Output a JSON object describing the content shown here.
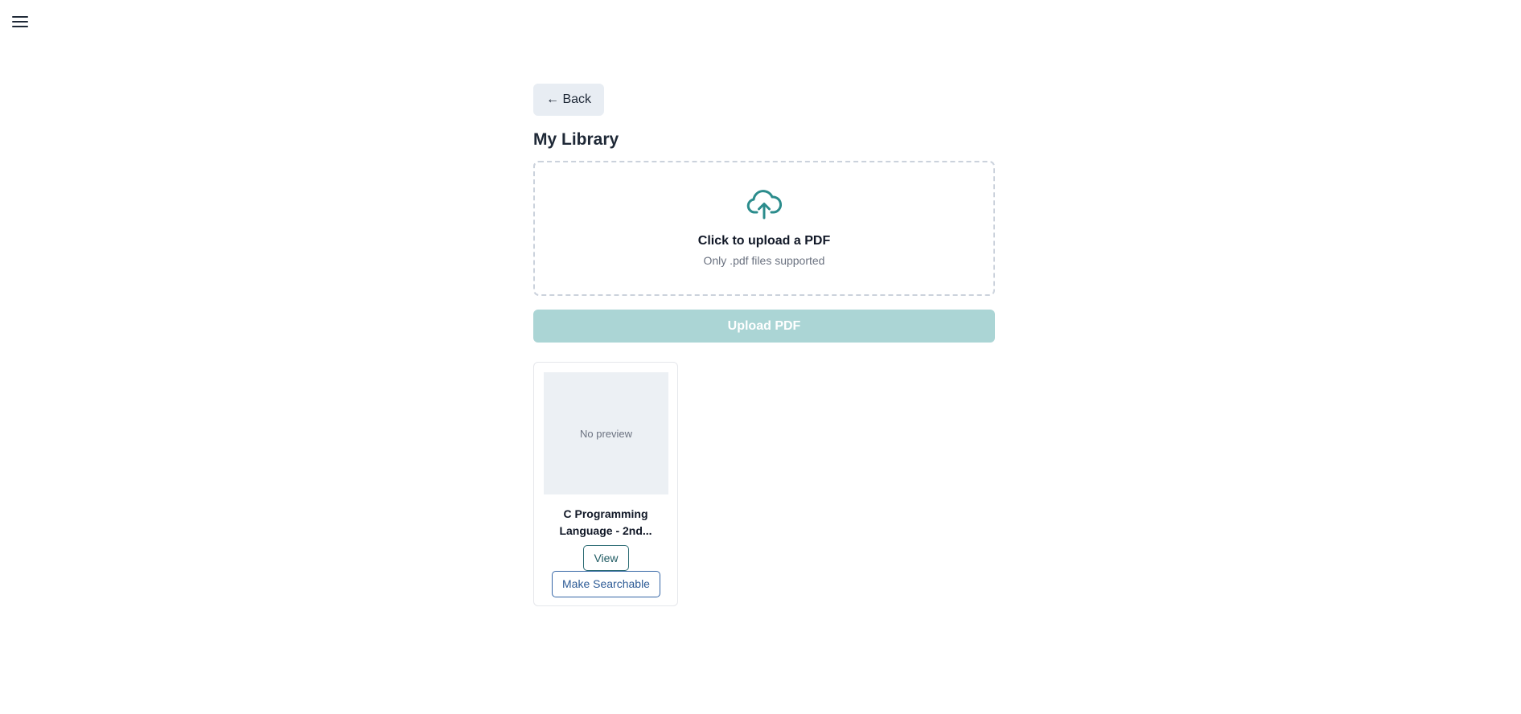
{
  "nav": {
    "menu_icon": "hamburger-menu-icon"
  },
  "header": {
    "back_label": "← Back",
    "title": "My Library"
  },
  "upload": {
    "icon": "cloud-upload-icon",
    "prompt": "Click to upload a PDF",
    "hint": "Only .pdf files supported",
    "button_label": "Upload PDF",
    "accent_color": "#2b8c8c",
    "button_color_disabled": "#abd5d5"
  },
  "library": {
    "items": [
      {
        "preview_text": "No preview",
        "title": "C Programming Language - 2nd...",
        "view_label": "View",
        "searchable_label": "Make Searchable"
      }
    ]
  }
}
